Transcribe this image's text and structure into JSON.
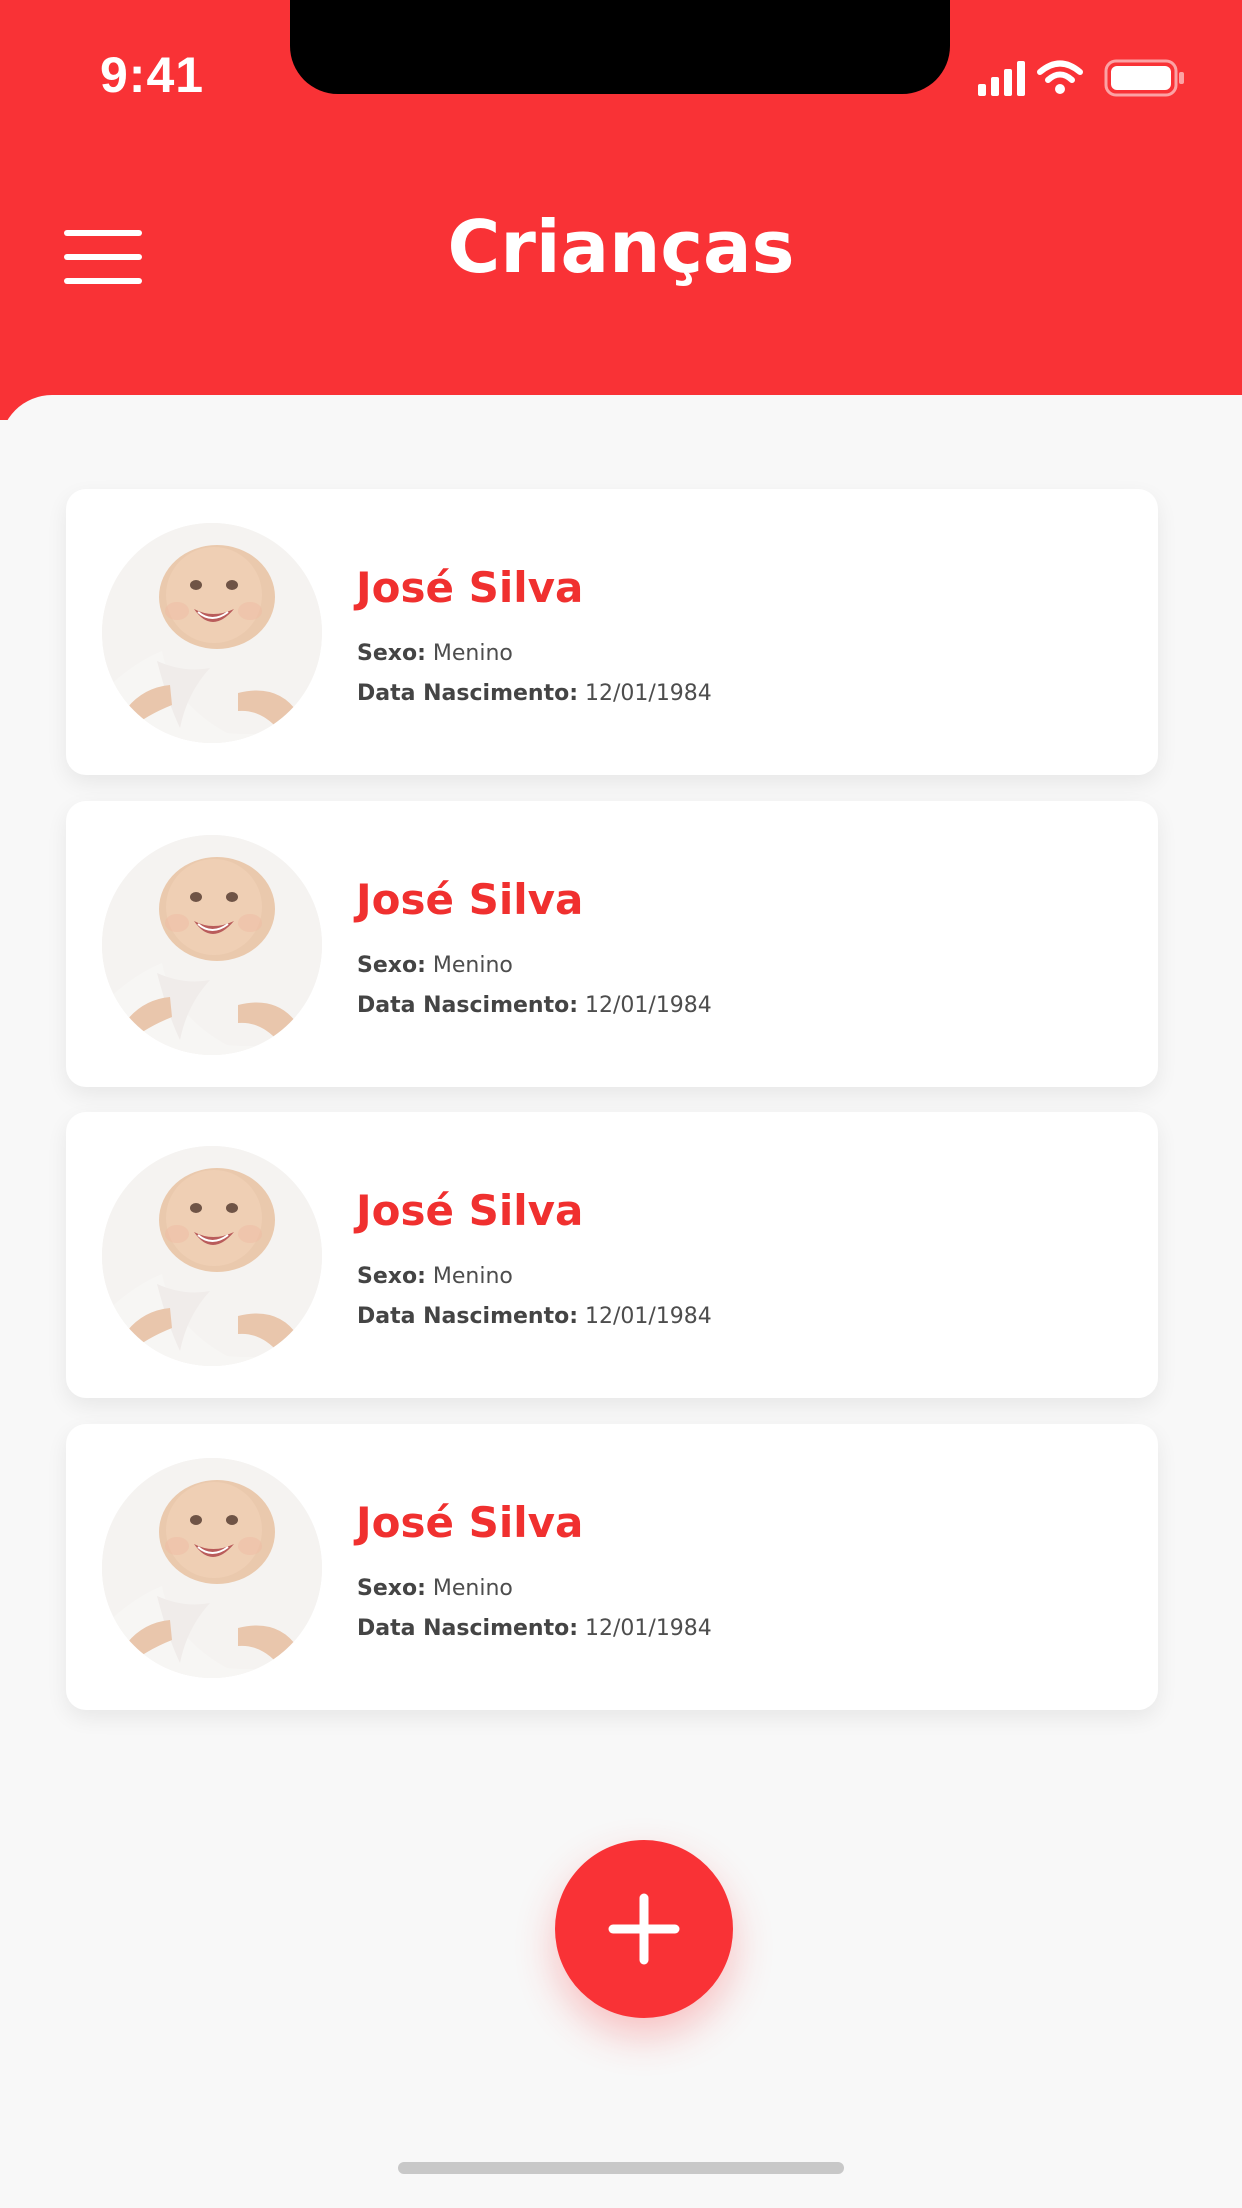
{
  "status_bar": {
    "time": "9:41"
  },
  "header": {
    "title": "Crianças",
    "menu_icon": "hamburger-icon"
  },
  "children": [
    {
      "name": "José Silva",
      "sex_label": "Sexo:",
      "sex_value": "Menino",
      "birth_label": "Data Nascimento:",
      "birth_value": "12/01/1984",
      "avatar_icon": "baby-photo"
    },
    {
      "name": "José Silva",
      "sex_label": "Sexo:",
      "sex_value": "Menino",
      "birth_label": "Data Nascimento:",
      "birth_value": "12/01/1984",
      "avatar_icon": "baby-photo"
    },
    {
      "name": "José Silva",
      "sex_label": "Sexo:",
      "sex_value": "Menino",
      "birth_label": "Data Nascimento:",
      "birth_value": "12/01/1984",
      "avatar_icon": "baby-photo"
    },
    {
      "name": "José Silva",
      "sex_label": "Sexo:",
      "sex_value": "Menino",
      "birth_label": "Data Nascimento:",
      "birth_value": "12/01/1984",
      "avatar_icon": "baby-photo"
    }
  ],
  "fab": {
    "icon": "plus-icon"
  },
  "colors": {
    "primary": "#f93236",
    "background": "#f8f8f8",
    "card": "#ffffff",
    "name_text": "#f0302f",
    "body_text": "#4d4d4d"
  }
}
